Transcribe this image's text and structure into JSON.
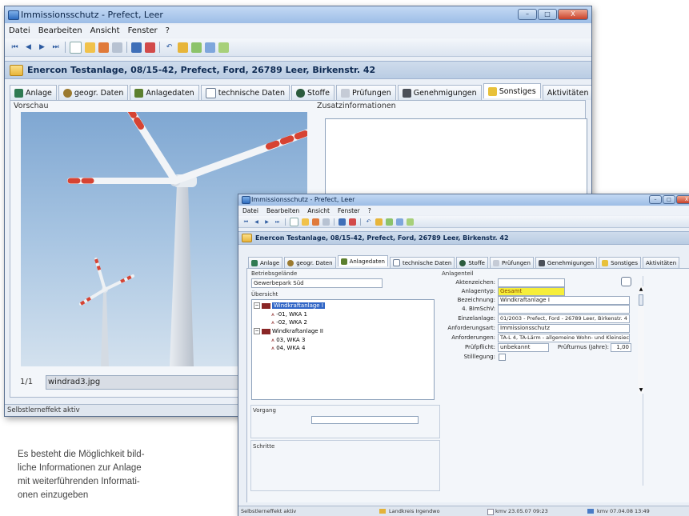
{
  "back_window": {
    "title": "Immissionsschutz - Prefect, Leer",
    "window_controls": {
      "minimize": "–",
      "maximize": "□",
      "close": "X"
    },
    "menu": [
      "Datei",
      "Bearbeiten",
      "Ansicht",
      "Fenster",
      "?"
    ],
    "record_header": "Enercon Testanlage, 08/15-42, Prefect, Ford, 26789 Leer, Birkenstr. 42",
    "tabs": [
      {
        "label": "Anlage",
        "icon": "plant-icon"
      },
      {
        "label": "geogr. Daten",
        "icon": "globe-icon"
      },
      {
        "label": "Anlagedaten",
        "icon": "tree-icon"
      },
      {
        "label": "technische Daten",
        "icon": "document-icon"
      },
      {
        "label": "Stoffe",
        "icon": "barrel-icon"
      },
      {
        "label": "Prüfungen",
        "icon": "hourglass-icon"
      },
      {
        "label": "Genehmigungen",
        "icon": "permit-icon"
      },
      {
        "label": "Sonstiges",
        "icon": "edit-icon"
      },
      {
        "label": "Aktivitäten",
        "icon": ""
      }
    ],
    "active_tab": "Sonstiges",
    "preview_label": "Vorschau",
    "additional_info_label": "Zusatzinformationen",
    "image_counter": "1/1",
    "image_filename": "windrad3.jpg",
    "status": "Selbstlerneffekt aktiv"
  },
  "front_window": {
    "title": "Immissionsschutz - Prefect, Leer",
    "menu": [
      "Datei",
      "Bearbeiten",
      "Ansicht",
      "Fenster",
      "?"
    ],
    "record_header": "Enercon Testanlage, 08/15-42, Prefect, Ford, 26789 Leer, Birkenstr. 42",
    "tabs": [
      {
        "label": "Anlage",
        "icon": "plant-icon"
      },
      {
        "label": "geogr. Daten",
        "icon": "globe-icon"
      },
      {
        "label": "Anlagedaten",
        "icon": "tree-icon"
      },
      {
        "label": "technische Daten",
        "icon": "document-icon"
      },
      {
        "label": "Stoffe",
        "icon": "barrel-icon"
      },
      {
        "label": "Prüfungen",
        "icon": "hourglass-icon"
      },
      {
        "label": "Genehmigungen",
        "icon": "permit-icon"
      },
      {
        "label": "Sonstiges",
        "icon": "edit-icon"
      },
      {
        "label": "Aktivitäten",
        "icon": ""
      }
    ],
    "active_tab": "Anlagedaten",
    "betriebsgelaende": {
      "label": "Betriebsgelände",
      "value": "Gewerbepark Süd"
    },
    "overview_label": "Übersicht",
    "tree": [
      {
        "label": "Windkraftanlage I",
        "selected": true,
        "children": [
          "-01, WKA 1",
          "-02, WKA 2"
        ]
      },
      {
        "label": "Windkraftanlage II",
        "selected": false,
        "children": [
          "03, WKA 3",
          "04, WKA 4"
        ]
      }
    ],
    "anlagenteil_label": "Anlagenteil",
    "fields": [
      {
        "label": "Aktenzeichen:",
        "value": ""
      },
      {
        "label": "Anlagentyp:",
        "value": "Gesamt"
      },
      {
        "label": "Bezeichnung:",
        "value": "Windkraftanlage I"
      },
      {
        "label": "4. BImSchV:",
        "value": ""
      },
      {
        "label": "Einzelanlage:",
        "value": "01/2003 - Prefect, Ford - 26789 Leer, Birkenstr. 4"
      },
      {
        "label": "Anforderungsart:",
        "value": "Immissionsschutz"
      },
      {
        "label": "Anforderungen:",
        "value": "TA-L 4, TA-Lärm - allgemeine Wohn- und Kleinsiec"
      },
      {
        "label": "Prüfpflicht:",
        "value": "unbekannt"
      },
      {
        "label": "Stilllegung:",
        "value": ""
      }
    ],
    "pruefturnus": {
      "label": "Prüfturnus (Jahre):",
      "value": "1,00"
    },
    "vorgang_label": "Vorgang",
    "schritte_label": "Schritte",
    "status": {
      "left": "Selbstlerneffekt aktiv",
      "district": "Landkreis Irgendwo",
      "created": "kmv 23.05.07 09:23",
      "modified": "kmv 07.04.08 13:49"
    },
    "colors": {
      "highlight_field": "#f6ee3a",
      "selection": "#3166c6"
    }
  },
  "caption": {
    "lines": [
      "Es besteht die Möglichkeit bild-",
      "liche Informationen zur Anlage",
      "mit weiterführenden Informati-",
      "onen einzugeben"
    ]
  }
}
